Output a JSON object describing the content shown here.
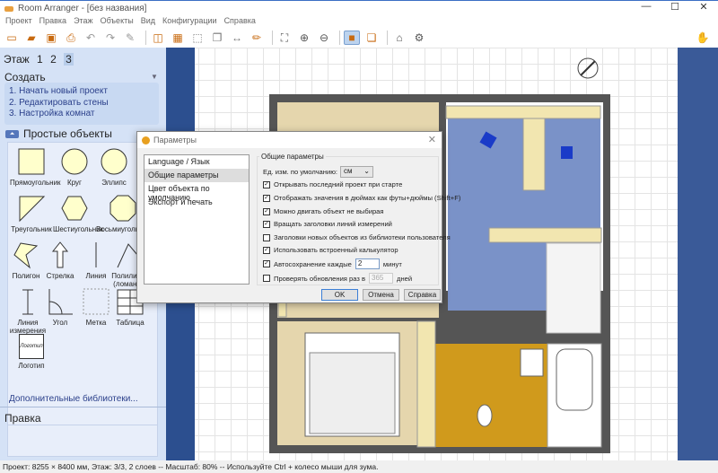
{
  "window": {
    "title": "Room Arranger - [без названия]",
    "min": "—",
    "max": "☐",
    "close": "✕"
  },
  "menu": [
    "Проект",
    "Правка",
    "Этаж",
    "Объекты",
    "Вид",
    "Конфигурации",
    "Справка"
  ],
  "sidebar": {
    "floor_label": "Этаж",
    "floors": [
      "1",
      "2",
      "3"
    ],
    "create_title": "Создать",
    "create_items": [
      "1. Начать новый проект",
      "2. Редактировать стены",
      "3. Настройка комнат"
    ],
    "simple_title": "Простые объекты",
    "objects": [
      "Прямоугольник",
      "Круг",
      "Эллипс",
      "Треугольник",
      "Шестиугольник",
      "Восьмиугольник",
      "Полигон",
      "Стрелка",
      "Линия",
      "Полилиния (ломаная)",
      "Линия измерения",
      "Угол",
      "Метка",
      "Таблица",
      "Логотип"
    ],
    "logo_text": "Логотип",
    "more_libs": "Дополнительные библиотеки...",
    "edit_title": "Правка"
  },
  "dialog": {
    "title": "Параметры",
    "close": "✕",
    "categories": [
      "Language / Язык",
      "Общие параметры",
      "Цвет объекта по умолчанию",
      "Экспорт и печать"
    ],
    "group_title": "Общие параметры",
    "unit_label": "Ед. изм. по умолчанию:",
    "unit_value": "см",
    "options": [
      {
        "label": "Открывать последний проект при старте",
        "checked": true
      },
      {
        "label": "Отображать значения в дюймах как футы+дюймы (Shift+F)",
        "checked": true
      },
      {
        "label": "Можно двигать объект не выбирая",
        "checked": true
      },
      {
        "label": "Вращать заголовки линий измерений",
        "checked": true
      },
      {
        "label": "Заголовки новых объектов из библиотеки пользователя",
        "checked": false
      },
      {
        "label": "Использовать встроенный калькулятор",
        "checked": true
      }
    ],
    "autosave": {
      "label": "Автосохранение каждые",
      "value": "2",
      "unit": "минут",
      "checked": true
    },
    "updates": {
      "label": "Проверять обновления раз в",
      "value": "365",
      "unit": "дней",
      "checked": false
    },
    "ok": "OK",
    "cancel": "Отмена",
    "help": "Справка"
  },
  "status": "Проект: 8255 × 8400 мм, Этаж: 3/3, 2 слоев -- Масштаб: 80% -- Используйте Ctrl + колесо мыши для зума."
}
